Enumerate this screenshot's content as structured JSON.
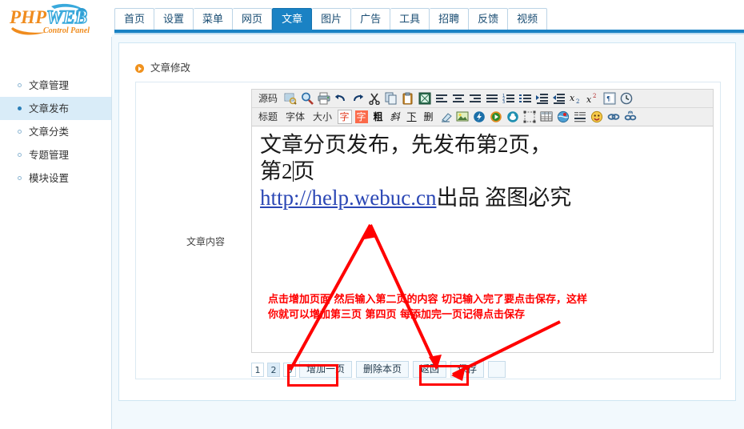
{
  "brand": {
    "name": "PHPWEB",
    "tagline": "Control Panel"
  },
  "nav": {
    "tabs": [
      {
        "label": "首页",
        "active": false
      },
      {
        "label": "设置",
        "active": false
      },
      {
        "label": "菜单",
        "active": false
      },
      {
        "label": "网页",
        "active": false
      },
      {
        "label": "文章",
        "active": true
      },
      {
        "label": "图片",
        "active": false
      },
      {
        "label": "广告",
        "active": false
      },
      {
        "label": "工具",
        "active": false
      },
      {
        "label": "招聘",
        "active": false
      },
      {
        "label": "反馈",
        "active": false
      },
      {
        "label": "视频",
        "active": false
      }
    ]
  },
  "sidebar": {
    "items": [
      {
        "label": "文章管理",
        "selected": false
      },
      {
        "label": "文章发布",
        "selected": true
      },
      {
        "label": "文章分类",
        "selected": false
      },
      {
        "label": "专题管理",
        "selected": false
      },
      {
        "label": "模块设置",
        "selected": false
      }
    ]
  },
  "panel": {
    "title": "文章修改",
    "field_label": "文章内容"
  },
  "editor": {
    "toolbar_row1": [
      {
        "name": "source-code",
        "type": "text",
        "label": "源码"
      },
      {
        "name": "preview-icon",
        "type": "icon"
      },
      {
        "name": "zoom-search-icon",
        "type": "icon"
      },
      {
        "name": "print-icon",
        "type": "icon"
      },
      {
        "name": "undo-icon",
        "type": "icon"
      },
      {
        "name": "redo-icon",
        "type": "icon"
      },
      {
        "name": "cut-scissors-icon",
        "type": "icon"
      },
      {
        "name": "copy-icon",
        "type": "icon"
      },
      {
        "name": "paste-icon",
        "type": "icon"
      },
      {
        "name": "paste-from-word-icon",
        "type": "icon"
      },
      {
        "name": "align-left-icon",
        "type": "icon"
      },
      {
        "name": "align-center-icon",
        "type": "icon"
      },
      {
        "name": "align-right-icon",
        "type": "icon"
      },
      {
        "name": "align-justify-icon",
        "type": "icon"
      },
      {
        "name": "numbered-list-icon",
        "type": "icon"
      },
      {
        "name": "bulleted-list-icon",
        "type": "icon"
      },
      {
        "name": "indent-increase-icon",
        "type": "icon"
      },
      {
        "name": "indent-decrease-icon",
        "type": "icon"
      },
      {
        "name": "subscript-icon",
        "type": "icon"
      },
      {
        "name": "superscript-icon",
        "type": "icon"
      },
      {
        "name": "page-break-icon",
        "type": "icon"
      },
      {
        "name": "clock-icon",
        "type": "icon"
      }
    ],
    "toolbar_row2": [
      {
        "name": "format-heading",
        "type": "text",
        "label": "标题"
      },
      {
        "name": "font-family",
        "type": "text",
        "label": "字体"
      },
      {
        "name": "font-size",
        "type": "text",
        "label": "大小"
      },
      {
        "name": "text-color-icon",
        "type": "icon",
        "glyph": "字"
      },
      {
        "name": "background-color-icon",
        "type": "icon",
        "glyph": "字"
      },
      {
        "name": "bold-icon",
        "type": "icon",
        "glyph": "粗"
      },
      {
        "name": "italic-icon",
        "type": "icon",
        "glyph": "斜"
      },
      {
        "name": "underline-icon",
        "type": "icon",
        "glyph": "下"
      },
      {
        "name": "strikethrough-icon",
        "type": "icon",
        "glyph": "删"
      },
      {
        "name": "remove-format-eraser-icon",
        "type": "icon"
      },
      {
        "name": "insert-image-icon",
        "type": "icon"
      },
      {
        "name": "insert-flash-icon",
        "type": "icon"
      },
      {
        "name": "insert-media-player-icon",
        "type": "icon"
      },
      {
        "name": "insert-realplayer-icon",
        "type": "icon"
      },
      {
        "name": "insert-frame-icon",
        "type": "icon"
      },
      {
        "name": "insert-table-icon",
        "type": "icon"
      },
      {
        "name": "insert-map-icon",
        "type": "icon"
      },
      {
        "name": "insert-horizontal-rule-icon",
        "type": "icon"
      },
      {
        "name": "insert-emoticon-icon",
        "type": "icon"
      },
      {
        "name": "insert-link-icon",
        "type": "icon"
      },
      {
        "name": "unlink-icon",
        "type": "icon"
      }
    ],
    "content": {
      "line1": "文章分页发布，先发布第2页，",
      "line2_before_caret": "第2",
      "line2_after_caret": "页",
      "line3_link": "http://help.webuc.cn",
      "line3_rest": "出品  盗图必究"
    }
  },
  "annotation": {
    "line1": "点击增加页面 然后输入第二页的内容 切记输入完了要点击保存，这样",
    "line2": "你就可以增加第三页 第四页 每添加完一页记得点击保存",
    "color": "#ff0000"
  },
  "pagination": {
    "pages": [
      {
        "label": "1",
        "current": false
      },
      {
        "label": "2",
        "current": true
      },
      {
        "label": "3",
        "current": false
      }
    ]
  },
  "actions": {
    "add_page": "增加一页",
    "delete_page": "删除本页",
    "back": "返回",
    "save": "保存"
  },
  "colors": {
    "accent": "#1a82c4",
    "sidebar_selected": "#d9ecf8",
    "annotation_red": "#ff0000",
    "title_marker": "#f0921e"
  }
}
